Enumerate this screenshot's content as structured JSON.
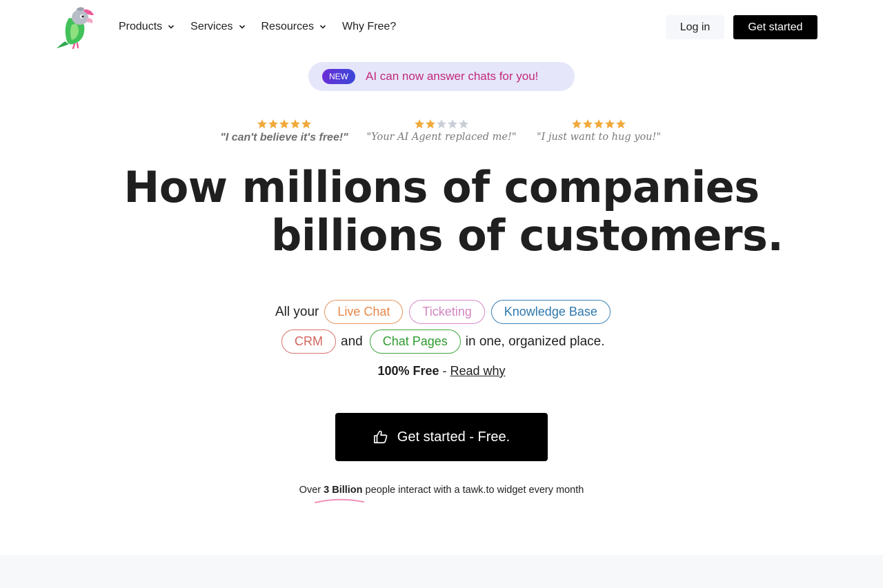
{
  "header": {
    "nav": [
      {
        "label": "Products",
        "has_dropdown": true
      },
      {
        "label": "Services",
        "has_dropdown": true
      },
      {
        "label": "Resources",
        "has_dropdown": true
      },
      {
        "label": "Why Free?",
        "has_dropdown": false
      }
    ],
    "login_label": "Log in",
    "get_started_label": "Get started"
  },
  "announcement": {
    "badge": "NEW",
    "text": "AI can now answer chats for you!"
  },
  "reviews": [
    {
      "stars": 5,
      "quote": "\"I can't believe it's free!\""
    },
    {
      "stars": 2,
      "quote": "\"Your AI Agent replaced me!\""
    },
    {
      "stars": 5,
      "quote": "\"I just want to hug you!\""
    }
  ],
  "headline": {
    "line1": "How millions of companies",
    "line2": "billions of customers."
  },
  "products": {
    "prefix": "All your",
    "live_chat": "Live Chat",
    "ticketing": "Ticketing",
    "knowledge_base": "Knowledge Base",
    "crm": "CRM",
    "and": "and",
    "chat_pages": "Chat Pages",
    "suffix": "in one, organized place."
  },
  "free": {
    "bold": "100% Free",
    "sep": " - ",
    "link": "Read why"
  },
  "cta": {
    "label": "Get started - Free."
  },
  "stat": {
    "prefix": "Over ",
    "highlight": "3 Billion",
    "suffix": " people interact with a tawk.to widget every month"
  },
  "colors": {
    "star_filled": "#f0a93b",
    "star_empty": "#c9ced6",
    "announce_bg": "#e6e6fb",
    "announce_text": "#c2297b"
  },
  "icons": {
    "logo": "parrot-logo",
    "nav_dropdown": "chevron-down-icon",
    "cta": "thumbs-up-icon"
  }
}
